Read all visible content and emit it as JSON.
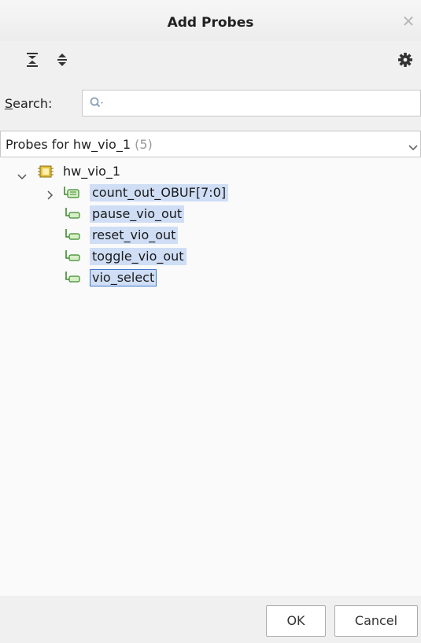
{
  "dialog": {
    "title": "Add Probes",
    "close_glyph": "✕"
  },
  "toolbar": {
    "collapse_all_icon": "collapse-all-icon",
    "expand_all_icon": "expand-all-icon",
    "settings_icon": "gear-icon"
  },
  "search": {
    "label_mnemonic": "S",
    "label_rest": "earch:",
    "value": "",
    "placeholder": ""
  },
  "probe_source": {
    "selected": "Probes for hw_vio_1",
    "count": "(5)"
  },
  "tree": {
    "root": {
      "label": "hw_vio_1",
      "expanded": true,
      "icon": "vio-core-icon"
    },
    "children": [
      {
        "label": "count_out_OBUF[7:0]",
        "icon": "bus-probe-icon",
        "expandable": true,
        "selected": true
      },
      {
        "label": "pause_vio_out",
        "icon": "net-probe-icon",
        "selected": true
      },
      {
        "label": "reset_vio_out",
        "icon": "net-probe-icon",
        "selected": true
      },
      {
        "label": "toggle_vio_out",
        "icon": "net-probe-icon",
        "selected": true
      },
      {
        "label": "vio_select",
        "icon": "net-probe-icon",
        "selected": true,
        "focused": true
      }
    ]
  },
  "buttons": {
    "ok": "OK",
    "cancel": "Cancel"
  },
  "colors": {
    "selection": "#cfdef5",
    "focus_border": "#3f78cc",
    "probe_icon_green": "#3a8a2a",
    "core_icon_gold": "#c8a020"
  }
}
